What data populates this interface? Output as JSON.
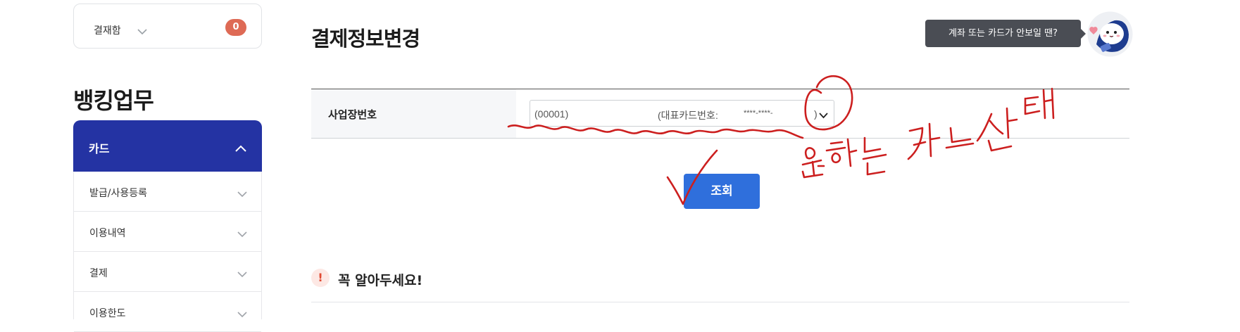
{
  "sidebar": {
    "pending": {
      "label": "결재함",
      "count": "0",
      "chevron_icon": "chevron-down-icon"
    },
    "section_title": "뱅킹업무",
    "active_item": {
      "label": "카드",
      "chevron_icon": "chevron-up-icon"
    },
    "items": [
      {
        "label": "발급/사용등록"
      },
      {
        "label": "이용내역"
      },
      {
        "label": "결제"
      },
      {
        "label": "이용한도"
      }
    ]
  },
  "main": {
    "page_title": "결제정보변경",
    "help_tooltip": "계좌 또는 카드가 안보일 땐?",
    "mascot_icon": "mascot-avatar",
    "form": {
      "label": "사업장번호",
      "select": {
        "prefix": "(00001)",
        "middle": "(대표카드번호:",
        "mask": "****-****-",
        "end": ")"
      }
    },
    "search_button": "조회",
    "notice": {
      "icon": "!",
      "title": "꼭 알아두세요!"
    }
  },
  "annotation": {
    "handwritten_note": "원하는 카드 선택",
    "color": "#cc1f1f"
  },
  "colors": {
    "sidebar_active": "#2433a3",
    "badge": "#de6a55",
    "button": "#2f6fdc",
    "tooltip": "#4a4d54"
  }
}
